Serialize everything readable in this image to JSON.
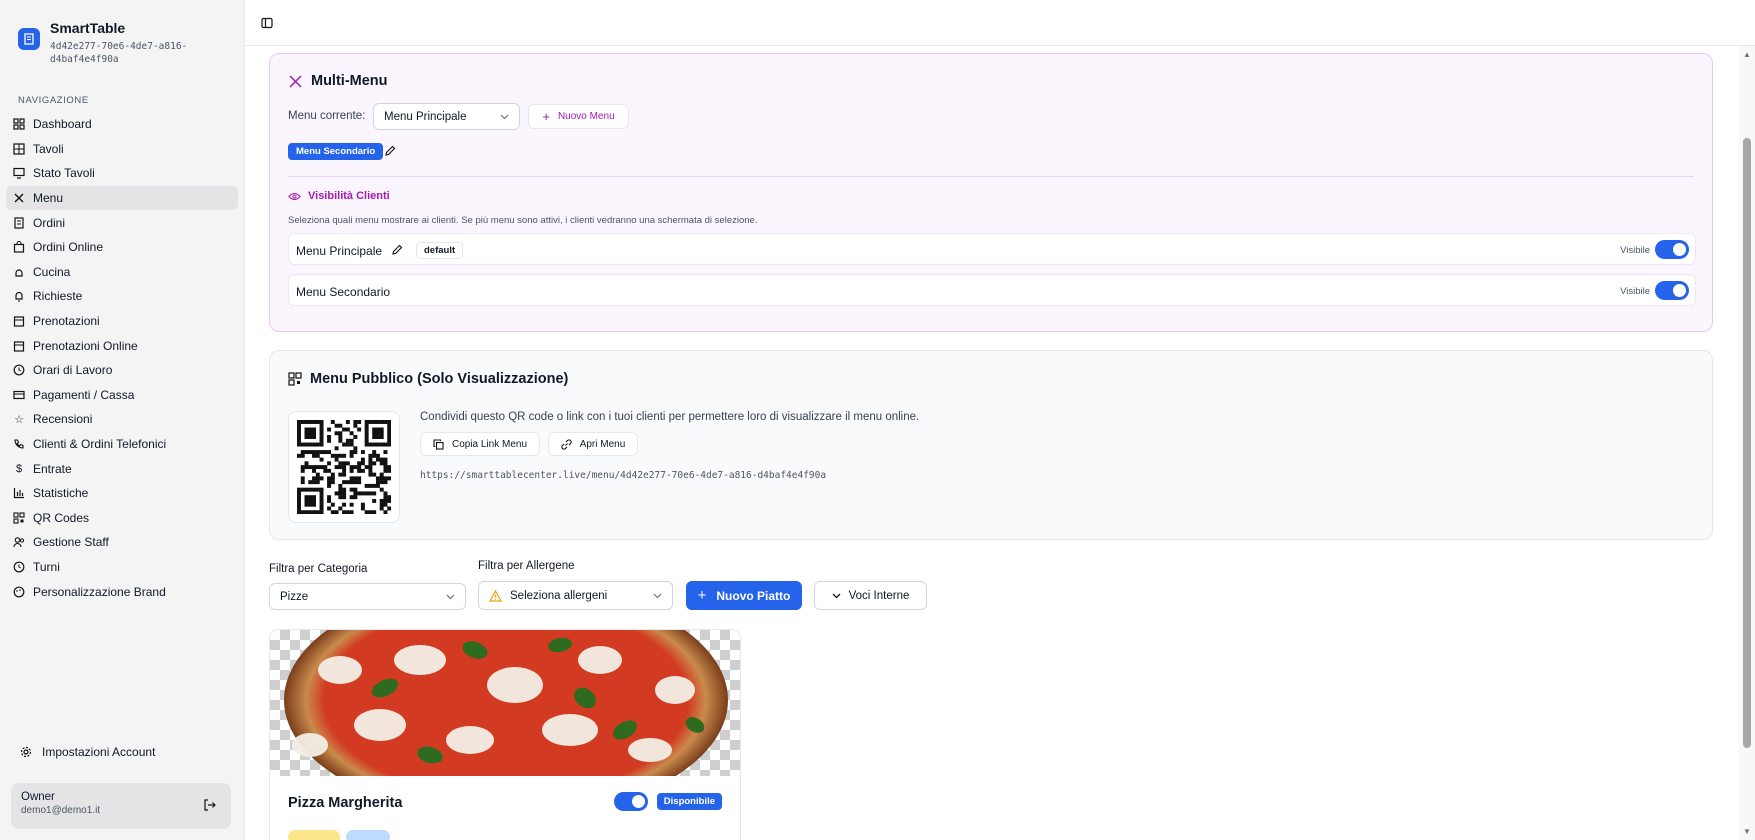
{
  "app": {
    "name": "SmartTable",
    "id": "4d42e277-70e6-4de7-a816-d4baf4e4f90a"
  },
  "sidebar": {
    "section_label": "NAVIGAZIONE",
    "items": [
      {
        "label": "Dashboard",
        "icon": "dashboard-icon"
      },
      {
        "label": "Tavoli",
        "icon": "table-grid-icon"
      },
      {
        "label": "Stato Tavoli",
        "icon": "monitor-icon"
      },
      {
        "label": "Menu",
        "icon": "utensils-icon",
        "active": true
      },
      {
        "label": "Ordini",
        "icon": "receipt-icon"
      },
      {
        "label": "Ordini Online",
        "icon": "shopping-bag-icon"
      },
      {
        "label": "Cucina",
        "icon": "chef-hat-icon"
      },
      {
        "label": "Richieste",
        "icon": "bell-icon"
      },
      {
        "label": "Prenotazioni",
        "icon": "calendar-icon"
      },
      {
        "label": "Prenotazioni Online",
        "icon": "calendar-online-icon"
      },
      {
        "label": "Orari di Lavoro",
        "icon": "clock-icon"
      },
      {
        "label": "Pagamenti / Cassa",
        "icon": "credit-card-icon"
      },
      {
        "label": "Recensioni",
        "icon": "star-icon"
      },
      {
        "label": "Clienti & Ordini Telefonici",
        "icon": "phone-icon"
      },
      {
        "label": "Entrate",
        "icon": "dollar-icon"
      },
      {
        "label": "Statistiche",
        "icon": "bar-chart-icon"
      },
      {
        "label": "QR Codes",
        "icon": "qr-code-icon"
      },
      {
        "label": "Gestione Staff",
        "icon": "users-icon"
      },
      {
        "label": "Turni",
        "icon": "clock-shift-icon"
      },
      {
        "label": "Personalizzazione Brand",
        "icon": "palette-icon"
      }
    ],
    "account_settings": "Impostazioni Account",
    "user": {
      "role": "Owner",
      "email": "demo1@demo1.it"
    }
  },
  "multi_menu": {
    "title": "Multi-Menu",
    "current_label": "Menu corrente:",
    "current_value": "Menu Principale",
    "new_menu_button": "Nuovo Menu",
    "menu_chip": "Menu Secondario",
    "visibility": {
      "title": "Visibilità Clienti",
      "description": "Seleziona quali menu mostrare ai clienti. Se più menu sono attivi, i clienti vedranno una schermata di selezione.",
      "rows": [
        {
          "name": "Menu Principale",
          "badge": "default",
          "status": "Visibile",
          "on": true
        },
        {
          "name": "Menu Secondario",
          "status": "Visibile",
          "on": true
        }
      ]
    }
  },
  "public_menu": {
    "title": "Menu Pubblico (Solo Visualizzazione)",
    "description": "Condividi questo QR code o link con i tuoi clienti per permettere loro di visualizzare il menu online.",
    "copy_button": "Copia Link Menu",
    "open_button": "Apri Menu",
    "url": "https://smarttablecenter.live/menu/4d42e277-70e6-4de7-a816-d4baf4e4f90a"
  },
  "filters": {
    "category_label": "Filtra per Categoria",
    "category_value": "Pizze",
    "allergen_label": "Filtra per Allergene",
    "allergen_placeholder": "Seleziona allergeni",
    "new_dish_button": "Nuovo Piatto",
    "internal_button": "Voci Interne"
  },
  "dishes": [
    {
      "name": "Pizza Margherita",
      "status": "Disponibile",
      "available": true
    }
  ],
  "colors": {
    "accent": "#2563eb",
    "purple": "#a21caf",
    "multi_menu_bg": "#fbf5fe",
    "warning": "#f59e0b"
  }
}
